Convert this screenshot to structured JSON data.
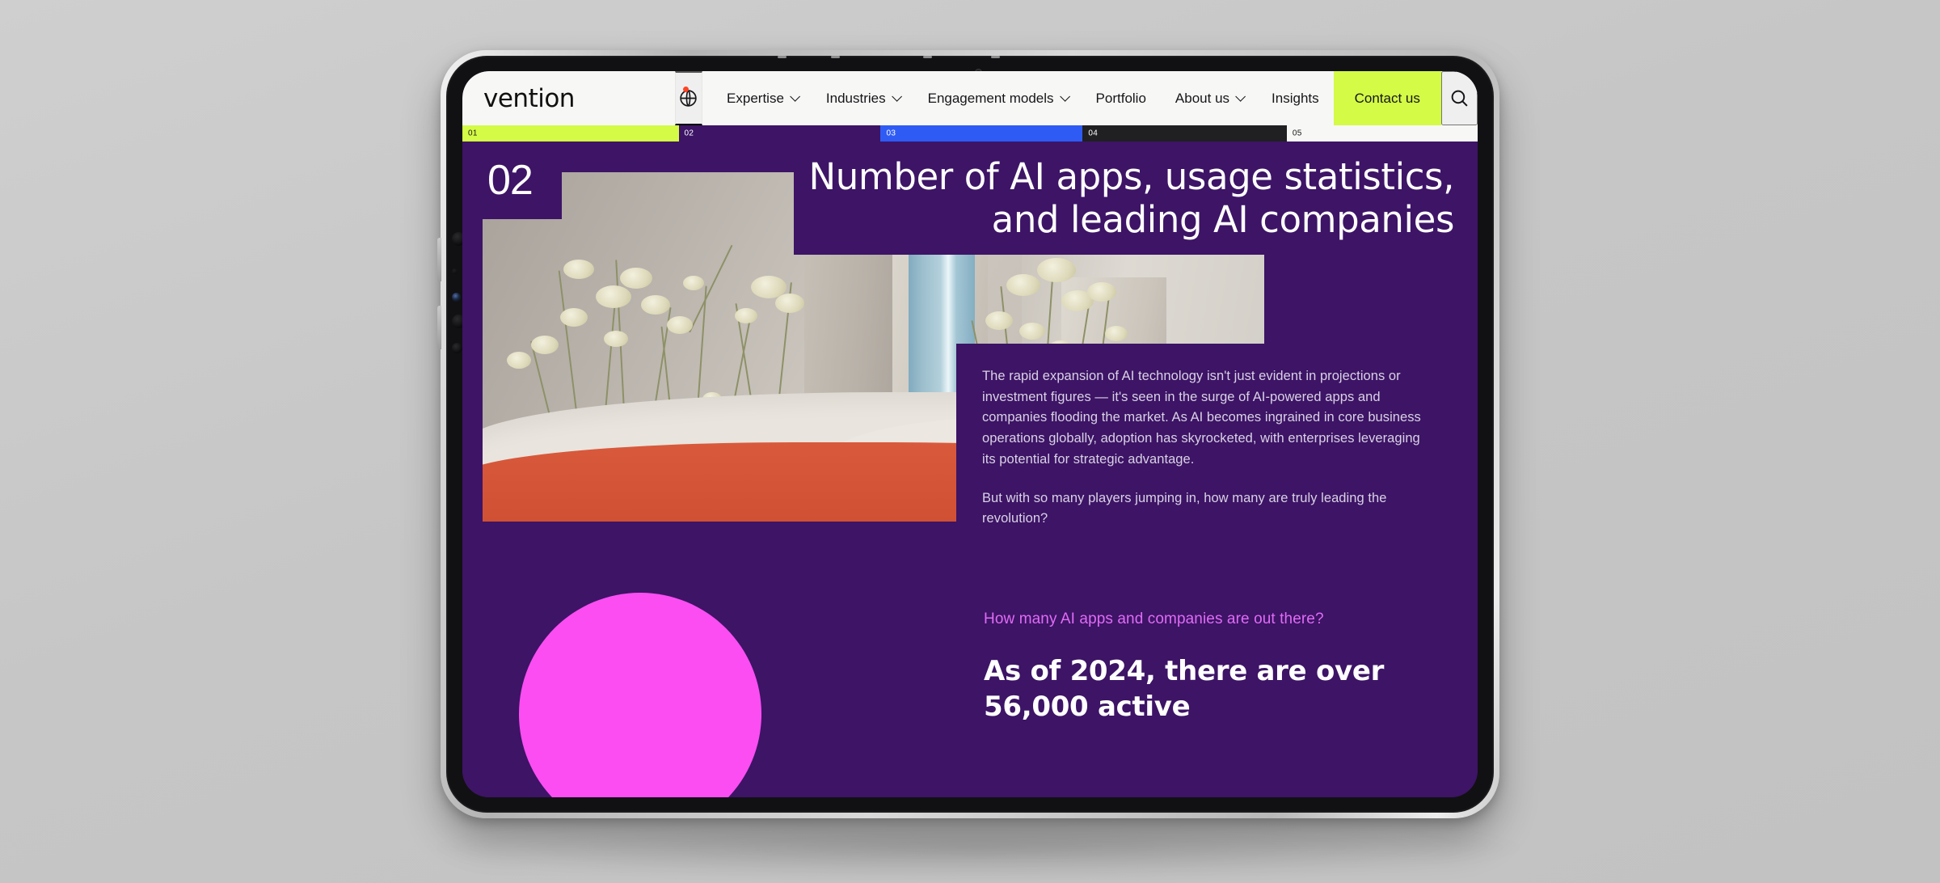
{
  "site": {
    "logo_text": "vention",
    "language_icon": "globe-icon",
    "search_icon": "search-icon"
  },
  "nav": {
    "items": [
      {
        "label": "Expertise",
        "has_dropdown": true
      },
      {
        "label": "Industries",
        "has_dropdown": true
      },
      {
        "label": "Engagement models",
        "has_dropdown": true
      },
      {
        "label": "Portfolio",
        "has_dropdown": false
      },
      {
        "label": "About us",
        "has_dropdown": true
      },
      {
        "label": "Insights",
        "has_dropdown": false
      }
    ],
    "cta_label": "Contact us"
  },
  "progress": {
    "segments": [
      {
        "number": "01",
        "color": "#d4fb46",
        "text_color": "#16161a",
        "width_pct": 21.3
      },
      {
        "number": "02",
        "color": "#3d1466",
        "text_color": "#ffffff",
        "width_pct": 19.9
      },
      {
        "number": "03",
        "color": "#2f5bf5",
        "text_color": "#ffffff",
        "width_pct": 19.9
      },
      {
        "number": "04",
        "color": "#201f22",
        "text_color": "#ffffff",
        "width_pct": 20.1
      },
      {
        "number": "05",
        "color": "#f7f7f5",
        "text_color": "#16161a",
        "width_pct": 18.8
      }
    ]
  },
  "hero": {
    "section_number": "02",
    "title_line_1": "Number of AI apps, usage statistics,",
    "title_line_2": "and leading AI companies",
    "paragraph_1": "The rapid expansion of AI technology isn't just evident in projections or investment figures — it's seen in the surge of AI-powered apps and companies flooding the market. As AI becomes ingrained in core business operations globally, adoption has skyrocketed, with enterprises leveraging its potential for strategic advantage.",
    "paragraph_2": "But with so many players jumping in, how many are truly leading the revolution?"
  },
  "lower": {
    "kicker": "How many AI apps and companies are out there?",
    "stat_headline": "As of 2024, there are over 56,000 active"
  },
  "colors": {
    "brand_purple": "#3d1466",
    "page_purple": "#2e1150",
    "accent_lime": "#d4fb46",
    "accent_magenta": "#fb4df2",
    "accent_pink_text": "#e06bf5",
    "accent_blue": "#2f5bf5"
  }
}
